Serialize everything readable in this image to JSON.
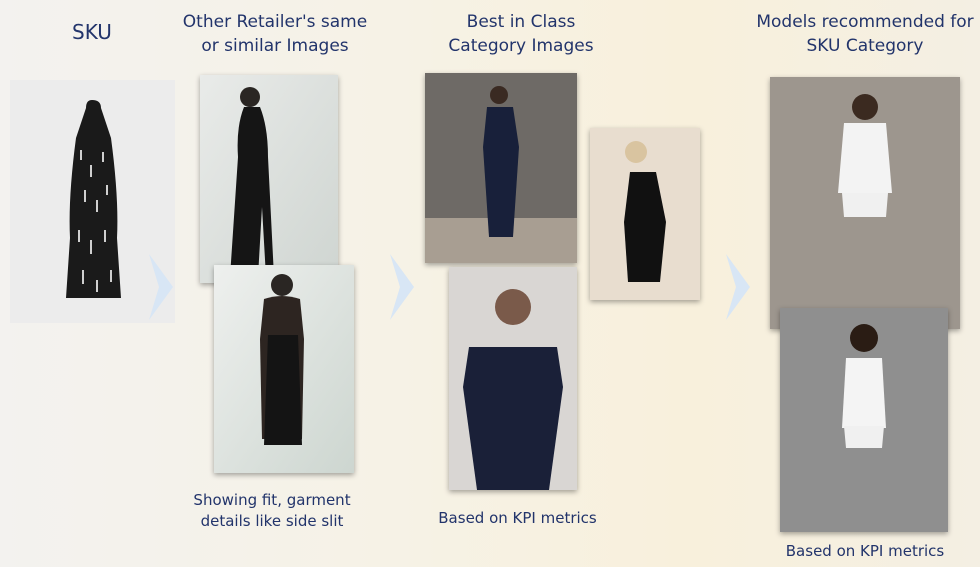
{
  "headings": {
    "sku": "SKU",
    "other_retailers": "Other Retailer's same or similar Images",
    "best_in_class": "Best in Class Category Images",
    "models": "Models recommended for SKU Category"
  },
  "captions": {
    "other_retailers": "Showing fit, garment details like side slit",
    "best_in_class": "Based on KPI metrics",
    "models": "Based on KPI metrics"
  },
  "images": {
    "sku_product": "black sequin halter dress product",
    "retailer_front": "model wearing halter dress side view",
    "retailer_back": "model wearing halter dress back view",
    "bic_1": "model in navy off-shoulder dress full length",
    "bic_2": "model in navy off-shoulder dress close",
    "bic_3": "model in black sequin slip dress",
    "model_1": "model in white shirt and shorts",
    "model_2": "model in white vest and shorts"
  },
  "colors": {
    "accent": "#22346b",
    "chevron": "#d8e6f5"
  }
}
